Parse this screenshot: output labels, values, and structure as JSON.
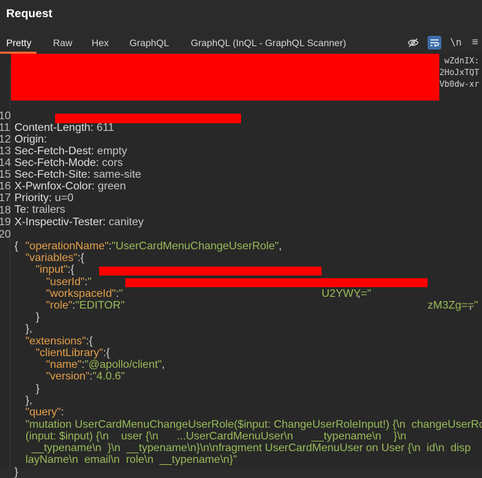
{
  "panel": {
    "title": "Request"
  },
  "tabs": [
    {
      "label": "Pretty"
    },
    {
      "label": "Raw"
    },
    {
      "label": "Hex"
    },
    {
      "label": "GraphQL"
    },
    {
      "label": "GraphQL (InQL - GraphQL Scanner)"
    }
  ],
  "toolbar": {
    "newline_label": "\\n",
    "menu_glyph": "≡"
  },
  "colors": {
    "active_tab_underline": "#ff6633",
    "json_key": "#e6a04a",
    "json_string": "#9bbb59",
    "redaction": "#ff0000"
  },
  "scrolled_right_fragments": [
    "wZdnIX:",
    "2HoJxTQT",
    "Vb0dw-xr"
  ],
  "headers": [
    {
      "num": "10",
      "name": "Content-Length:",
      "value": " 611"
    },
    {
      "num": "11",
      "name": "Origin:",
      "value": ""
    },
    {
      "num": "12",
      "name": "Sec-Fetch-Dest:",
      "value": " empty"
    },
    {
      "num": "13",
      "name": "Sec-Fetch-Mode:",
      "value": " cors"
    },
    {
      "num": "14",
      "name": "Sec-Fetch-Site:",
      "value": " same-site"
    },
    {
      "num": "15",
      "name": "X-Pwnfox-Color:",
      "value": " green"
    },
    {
      "num": "16",
      "name": "Priority:",
      "value": " u=0"
    },
    {
      "num": "17",
      "name": "Te:",
      "value": " trailers"
    },
    {
      "num": "18",
      "name": "X-Inspectiv-Tester:",
      "value": " canitey"
    }
  ],
  "body": {
    "line19_num": "19",
    "line20_num": "20",
    "open_brace": "{",
    "opName_key": "\"operationName\"",
    "opName_val": "\"UserCardMenuChangeUserRole\"",
    "variables_key": "\"variables\"",
    "input_key": "\"input\"",
    "userId_key": "\"userId\"",
    "userId_tail": "U2YWY=\"",
    "workspaceId_key": "\"workspaceId\"",
    "workspaceId_tail": "zM3Zg==\"",
    "role_key": "\"role\"",
    "role_val": "\"EDITOR\"",
    "extensions_key": "\"extensions\"",
    "clientLibrary_key": "\"clientLibrary\"",
    "name_key": "\"name\"",
    "name_val": "\"@apollo/client\"",
    "version_key": "\"version\"",
    "version_val": "\"4.0.6\"",
    "query_key": "\"query\"",
    "query_lines": [
      "\"mutation UserCardMenuChangeUserRole($input: ChangeUserRoleInput!) {\\n  changeUserRole",
      "(input: $input) {\\n    user {\\n      ...UserCardMenuUser\\n      __typename\\n    }\\n",
      "  __typename\\n  }\\n  __typename\\n}\\n\\nfragment UserCardMenuUser on User {\\n  id\\n  disp",
      "layName\\n  email\\n  role\\n  __typename\\n}\""
    ],
    "close_brace": "}"
  }
}
